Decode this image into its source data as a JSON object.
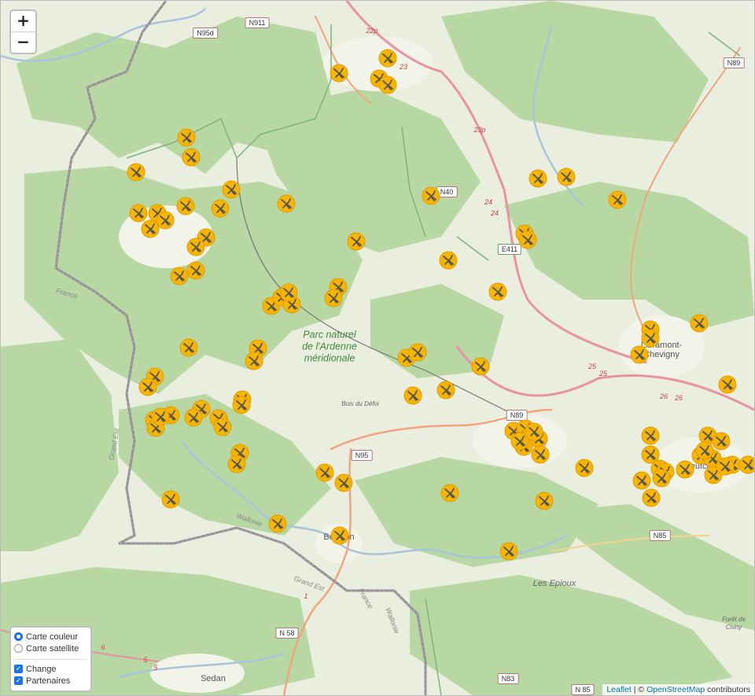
{
  "zoom": {
    "in_label": "+",
    "out_label": "−"
  },
  "layer_control": {
    "base_layers": [
      {
        "label": "Carte couleur",
        "selected": true
      },
      {
        "label": "Carte satellite",
        "selected": false
      }
    ],
    "overlays": [
      {
        "label": "Change",
        "checked": true
      },
      {
        "label": "Partenaires",
        "checked": true
      }
    ]
  },
  "attribution": {
    "leaflet": "Leaflet",
    "separator": " | © ",
    "osm": "OpenStreetMap",
    "suffix": " contributors"
  },
  "labels": {
    "park_line1": "Parc naturel",
    "park_line2": "de l'Ardenne",
    "park_line3": "méridionale",
    "town_libramont": "Libramont-Chevigny",
    "town_neufchateau": "Neufchâteau",
    "town_bouillon": "Bouillon",
    "town_sedan": "Sedan",
    "les_epioux": "Les Epioux",
    "bois_du_defoi": "Bois du Défoi",
    "foret_de_chiny": "Forêt de Chiny",
    "region_wallonie_1": "Wallonie",
    "region_wallonie_2": "Wallonie",
    "region_france_1": "France",
    "region_france_2": "France",
    "region_grand_est_1": "Grand Est",
    "region_grand_est_2": "Grand Est"
  },
  "road_shields": [
    "N911",
    "N95d",
    "N40",
    "E411",
    "N89",
    "N95",
    "N85",
    "N 58",
    "N83",
    "N 85",
    "N89"
  ],
  "ref_labels": [
    "22p",
    "23",
    "23p",
    "24",
    "24",
    "25",
    "25",
    "26",
    "26",
    "1",
    "6",
    "5",
    "5"
  ],
  "marker_icon": "satellite-dish-icon",
  "marker_color": "#f7b500",
  "marker_count": 95
}
